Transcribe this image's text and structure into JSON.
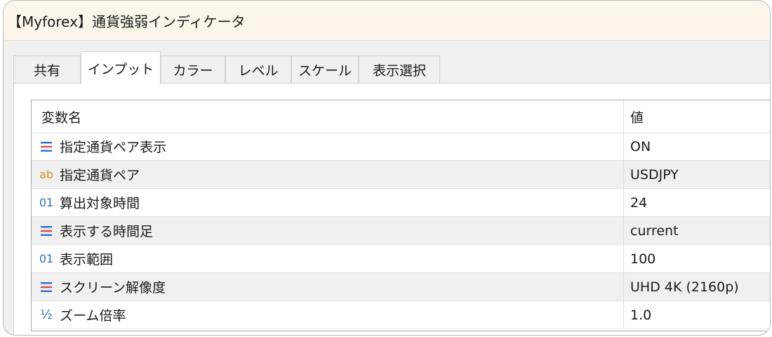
{
  "window": {
    "title": "【Myforex】通貨強弱インディケータ"
  },
  "tabs": [
    {
      "label": "共有",
      "active": false
    },
    {
      "label": "インプット",
      "active": true
    },
    {
      "label": "カラー",
      "active": false
    },
    {
      "label": "レベル",
      "active": false
    },
    {
      "label": "スケール",
      "active": false
    },
    {
      "label": "表示選択",
      "active": false
    }
  ],
  "table": {
    "headers": {
      "name": "変数名",
      "value": "値"
    },
    "rows": [
      {
        "icon": "enum-icon",
        "name": "指定通貨ペア表示",
        "value": "ON"
      },
      {
        "icon": "string-icon",
        "icon_text": "ab",
        "name": "指定通貨ペア",
        "value": "USDJPY"
      },
      {
        "icon": "integer-icon",
        "icon_text": "01",
        "name": "算出対象時間",
        "value": "24"
      },
      {
        "icon": "enum-icon",
        "name": "表示する時間足",
        "value": "current"
      },
      {
        "icon": "integer-icon",
        "icon_text": "01",
        "name": "表示範囲",
        "value": "100"
      },
      {
        "icon": "enum-icon",
        "name": "スクリーン解像度",
        "value": "UHD 4K (2160p)"
      },
      {
        "icon": "double-icon",
        "icon_text": "½",
        "name": "ズーム倍率",
        "value": "1.0"
      }
    ]
  },
  "colors": {
    "titlebar_bg": "#fbf6e9",
    "row_alt_bg": "#f0f0f0",
    "enum_icon_blue": "#2e6fd0",
    "enum_icon_red": "#d94a4a",
    "string_icon": "#c9962a",
    "integer_icon": "#2b6cc4",
    "double_icon": "#2b6cc4"
  }
}
